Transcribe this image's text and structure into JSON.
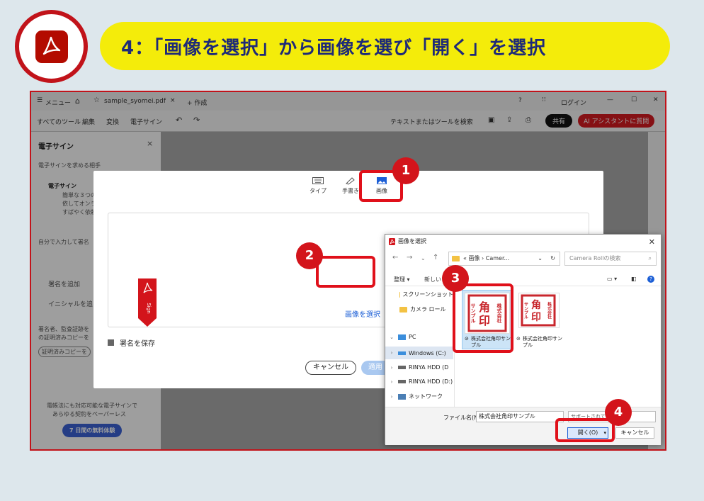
{
  "header": {
    "title": "4：「画像を選択」から画像を選び「開く」を選択"
  },
  "app": {
    "menu_label": "メニュー",
    "tab_filename": "sample_syomei.pdf",
    "new_tab_label": "+ 作成",
    "login_label": "ログイン",
    "toolbar_items": [
      "すべてのツール",
      "編集",
      "変換",
      "電子サイン"
    ],
    "search_placeholder": "テキストまたはツールを検索",
    "share_button": "共有",
    "ai_button": "AI アシスタントに質問"
  },
  "side_panel": {
    "title": "電子サイン",
    "close": "×",
    "subtitle": "電子サインを求める相手",
    "item_title": "電子サイン",
    "item_desc_1": "簡単な３つの",
    "item_desc_2": "依してオンラ",
    "item_desc_3": "すばやく依頼",
    "self_sign_label": "自分で入力して署名",
    "add_signature": "署名を追加",
    "add_initials": "イニシャルを追",
    "note_1": "署名者、監査証跡を",
    "note_2": "の証明済みコピーを",
    "certified_copy": "証明済みコピーを",
    "promo_1": "電帳法にも対応可能な電子サインで",
    "promo_2": "あらゆる契約をペーパーレス",
    "trial_button": "7 日間の無料体験"
  },
  "signature_dialog": {
    "tabs": [
      {
        "label": "タイプ",
        "icon": "keyboard-icon"
      },
      {
        "label": "手書き",
        "icon": "pen-icon"
      },
      {
        "label": "画像",
        "icon": "image-icon"
      }
    ],
    "ribbon_text": "Sign",
    "select_image_link": "画像を選択",
    "save_signature_label": "署名を保存",
    "cancel_button": "キャンセル",
    "apply_button": "適用"
  },
  "file_dialog": {
    "title": "画像を選択",
    "address_parts": [
      "«",
      "画像",
      "›",
      "Camer..."
    ],
    "search_placeholder": "Camera Rollの検索",
    "organize_label": "整理 ▾",
    "new_folder_label": "新しいフ",
    "tree": [
      {
        "label": "スクリーンショット",
        "type": "folder",
        "indent": false
      },
      {
        "label": "カメラ ロール",
        "type": "folder",
        "indent": false
      },
      {
        "label": "PC",
        "type": "pc",
        "expanded": true
      },
      {
        "label": "Windows (C:)",
        "type": "drive",
        "selected": true
      },
      {
        "label": "RINYA HDD (D",
        "type": "drive"
      },
      {
        "label": "RINYA HDD (D:)",
        "type": "drive"
      },
      {
        "label": "ネットワーク",
        "type": "network"
      }
    ],
    "files": [
      {
        "name": "株式会社角印サンプル",
        "selected": true
      },
      {
        "name": "株式会社角印サンプル",
        "selected": false
      }
    ],
    "stamp_text": {
      "big": [
        "角",
        "印"
      ],
      "small_right": "株式会社",
      "small_left": "サンプル"
    },
    "filename_label": "ファイル名(N):",
    "filename_value": "株式会社角印サンプル",
    "filetype_value": "サポートされている...jpg",
    "open_button": "開く(O)",
    "cancel_button": "キャンセル"
  },
  "callouts": [
    "1",
    "2",
    "3",
    "4"
  ],
  "colors": {
    "accent_red": "#d3141b",
    "title_bg": "#f4ec0a",
    "title_text": "#1e2a78",
    "page_bg": "#dde7ec",
    "stamp_red": "#c8262c"
  }
}
